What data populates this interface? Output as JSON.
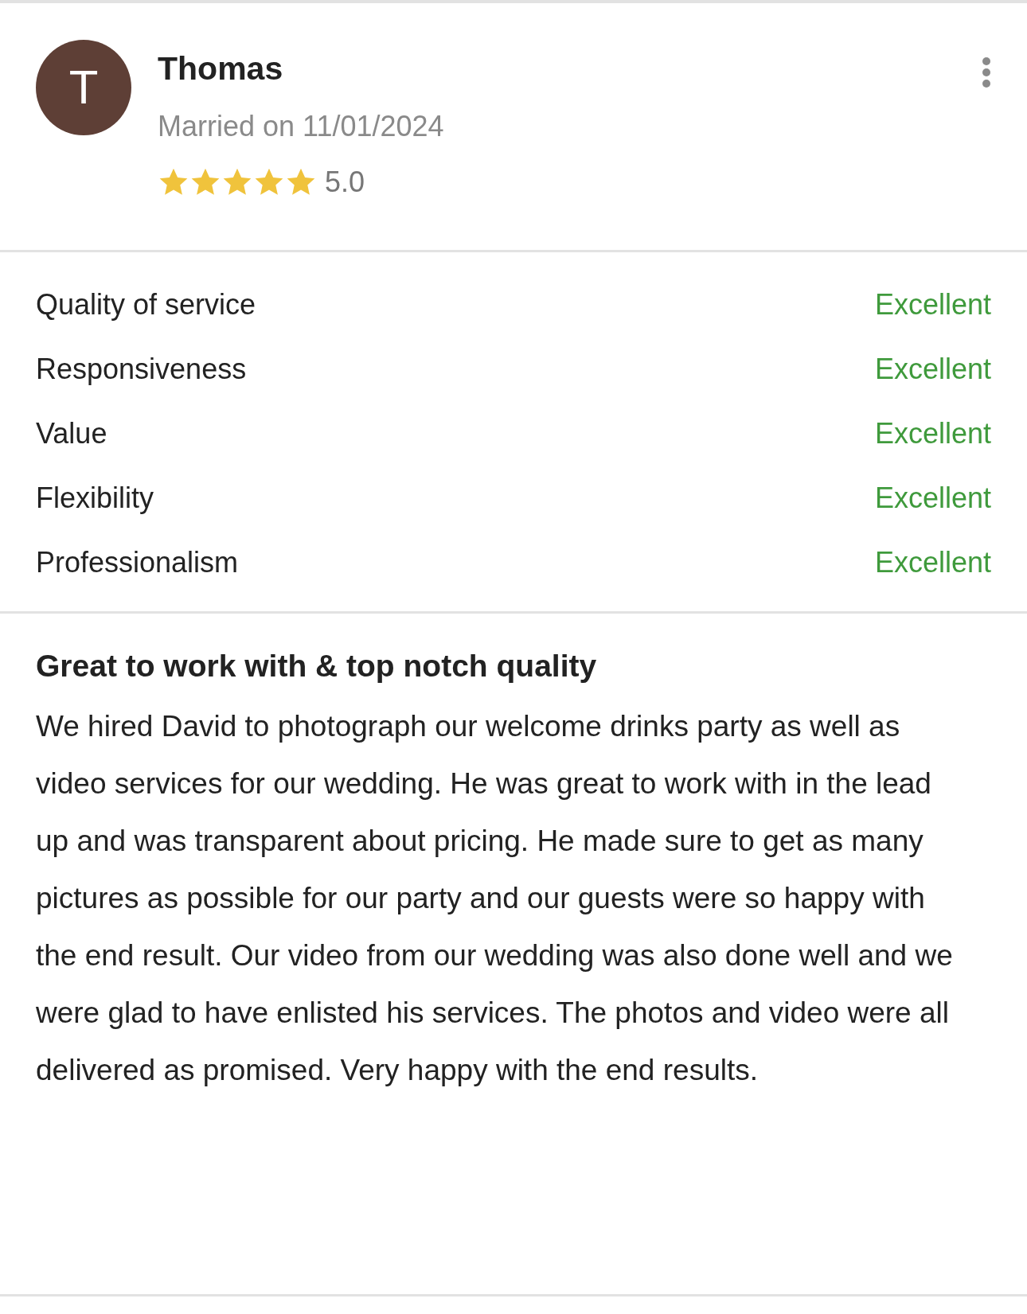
{
  "review": {
    "avatar_letter": "T",
    "name": "Thomas",
    "married": "Married on 11/01/2024",
    "stars": 5,
    "rating": "5.0"
  },
  "ratings": [
    {
      "label": "Quality of service",
      "value": "Excellent"
    },
    {
      "label": "Responsiveness",
      "value": "Excellent"
    },
    {
      "label": "Value",
      "value": "Excellent"
    },
    {
      "label": "Flexibility",
      "value": "Excellent"
    },
    {
      "label": "Professionalism",
      "value": "Excellent"
    }
  ],
  "title": "Great to work with & top notch quality",
  "body": "We hired David to photograph our welcome drinks party as well as video services for our wedding. He was great to work with in the lead up and was transparent about pricing. He made sure to get as many pictures as possible for our party and our guests were so happy with the end result. Our video from our wedding was also done well and we were glad to have enlisted his services. The photos and video were all delivered as promised. Very happy with the end results."
}
